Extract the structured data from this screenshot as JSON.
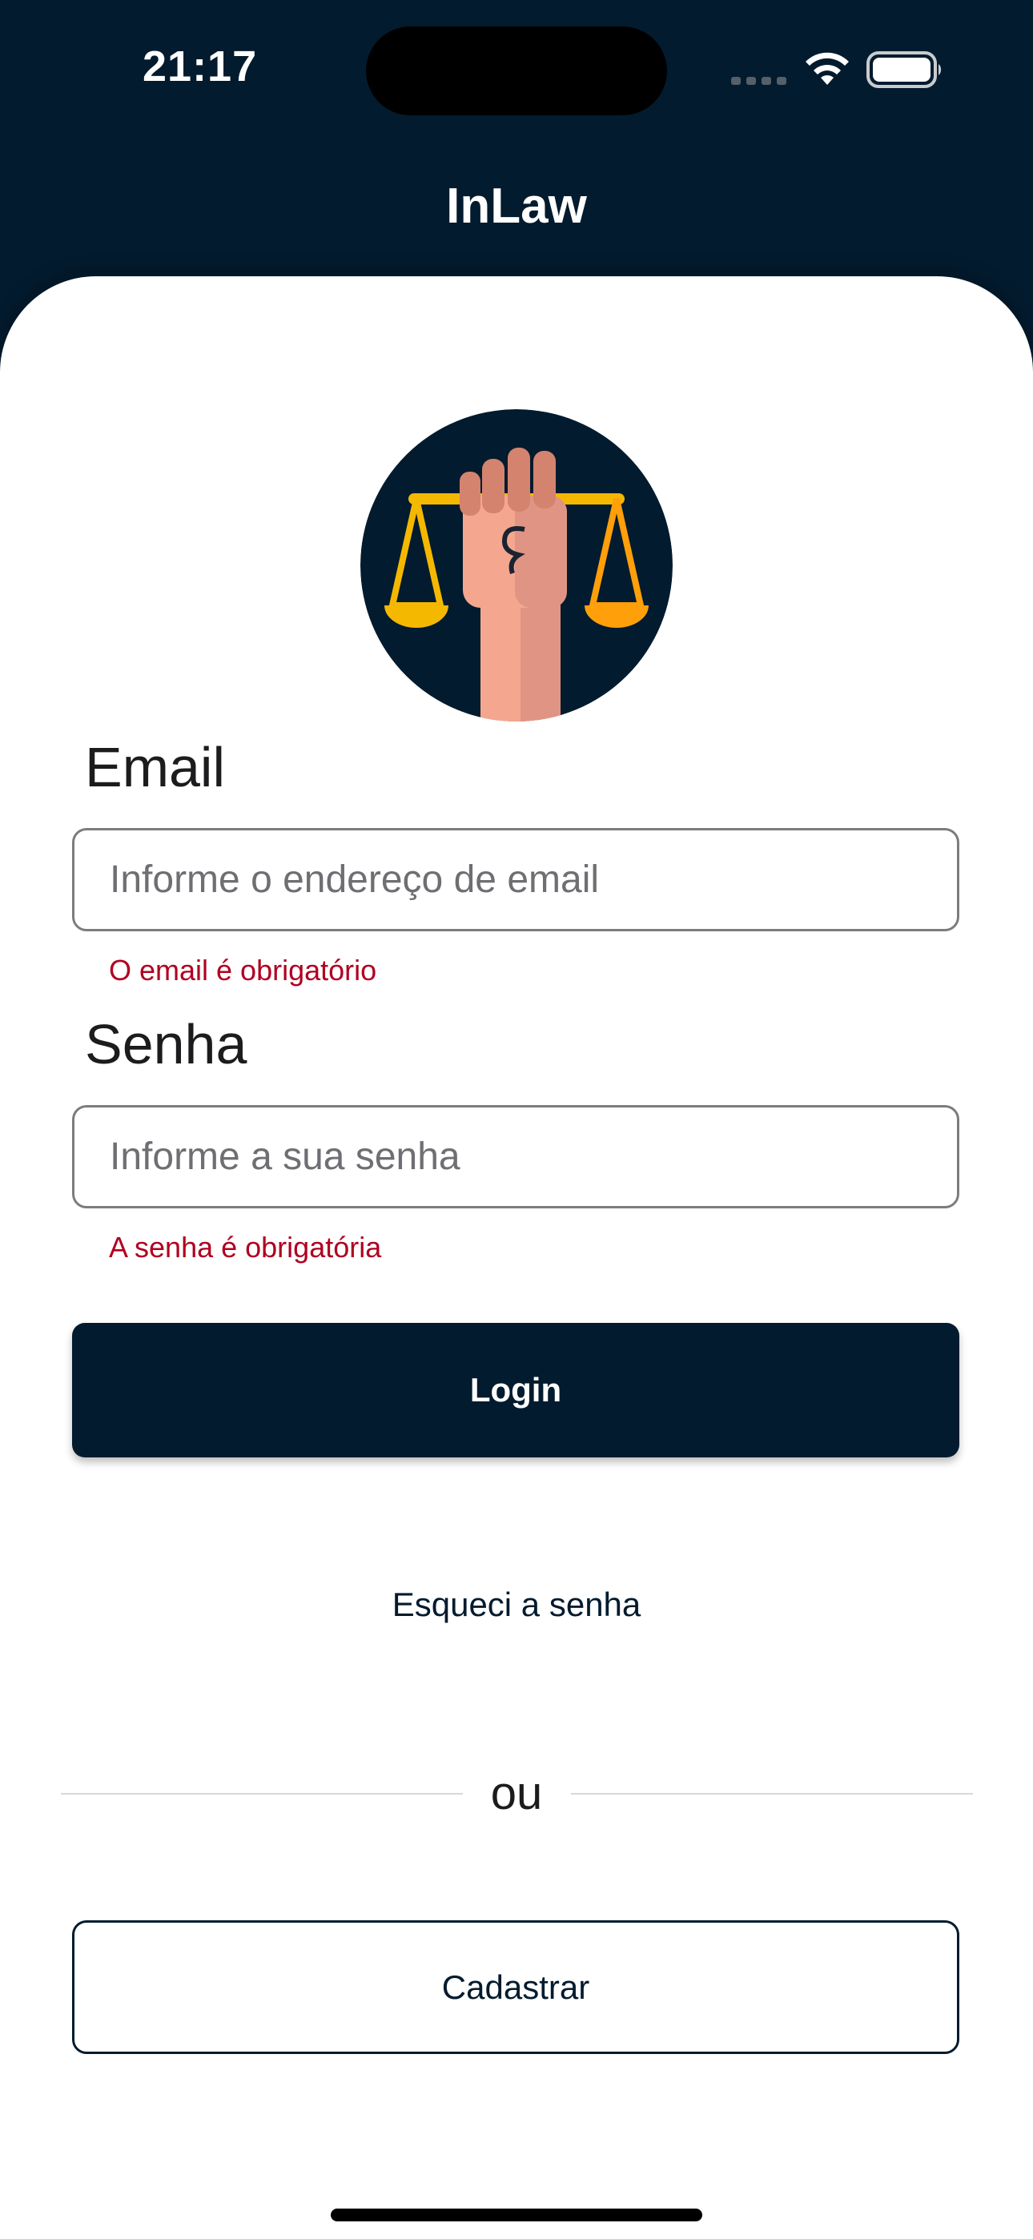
{
  "status_bar": {
    "time": "21:17"
  },
  "nav": {
    "title": "InLaw"
  },
  "form": {
    "email": {
      "label": "Email",
      "placeholder": "Informe o endereço de email",
      "error": "O email é obrigatório"
    },
    "password": {
      "label": "Senha",
      "placeholder": "Informe a sua senha",
      "error": "A senha é obrigatória"
    }
  },
  "actions": {
    "login_label": "Login",
    "forgot_label": "Esqueci a senha",
    "divider_label": "ou",
    "register_label": "Cadastrar"
  },
  "colors": {
    "primary": "#031b2e",
    "error": "#b00020",
    "accent_gold": "#f5b800"
  },
  "icons": [
    "cellular-signal-icon",
    "wifi-icon",
    "battery-icon",
    "justice-fist-logo"
  ]
}
